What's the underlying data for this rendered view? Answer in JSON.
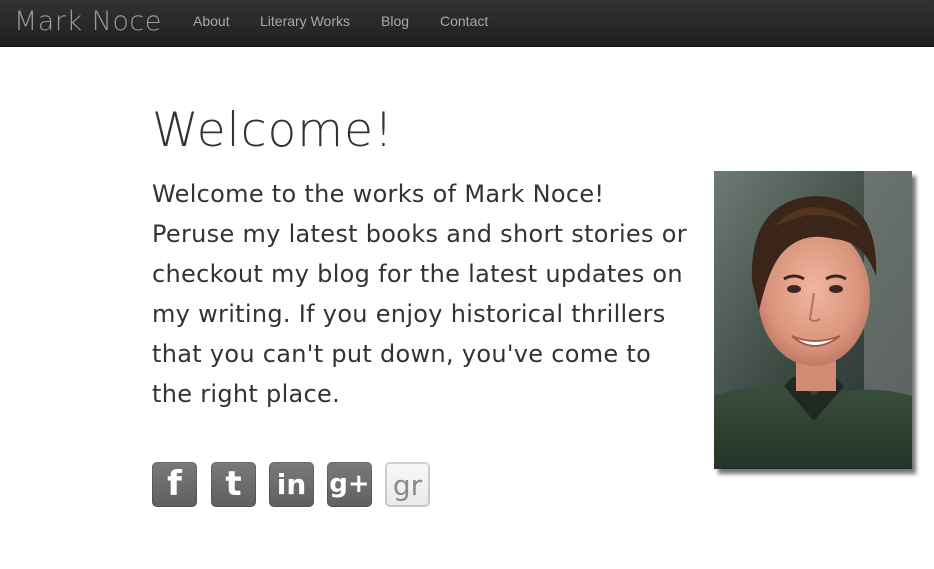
{
  "navbar": {
    "brand": "Mark Noce",
    "links": [
      {
        "label": "About"
      },
      {
        "label": "Literary Works"
      },
      {
        "label": "Blog"
      },
      {
        "label": "Contact"
      }
    ],
    "colors": {
      "background": "#2a2a2a",
      "text": "#a9a9a9"
    }
  },
  "main": {
    "heading": "Welcome!",
    "intro": "Welcome to the works of Mark Noce! Peruse my latest books and short stories or checkout my blog for the latest updates on my writing. If you enjoy historical thrillers that you can't put down, you've come to the right place.",
    "social": [
      {
        "network": "facebook",
        "glyph": "f",
        "icon": "facebook-icon"
      },
      {
        "network": "tumblr",
        "glyph": "t",
        "icon": "tumblr-icon"
      },
      {
        "network": "linkedin",
        "glyph": "in",
        "icon": "linkedin-icon"
      },
      {
        "network": "google-plus",
        "glyph": "g+",
        "icon": "google-plus-icon"
      },
      {
        "network": "goodreads",
        "glyph": "gr",
        "icon": "goodreads-icon"
      }
    ]
  },
  "photo": {
    "subject": "author-portrait"
  }
}
